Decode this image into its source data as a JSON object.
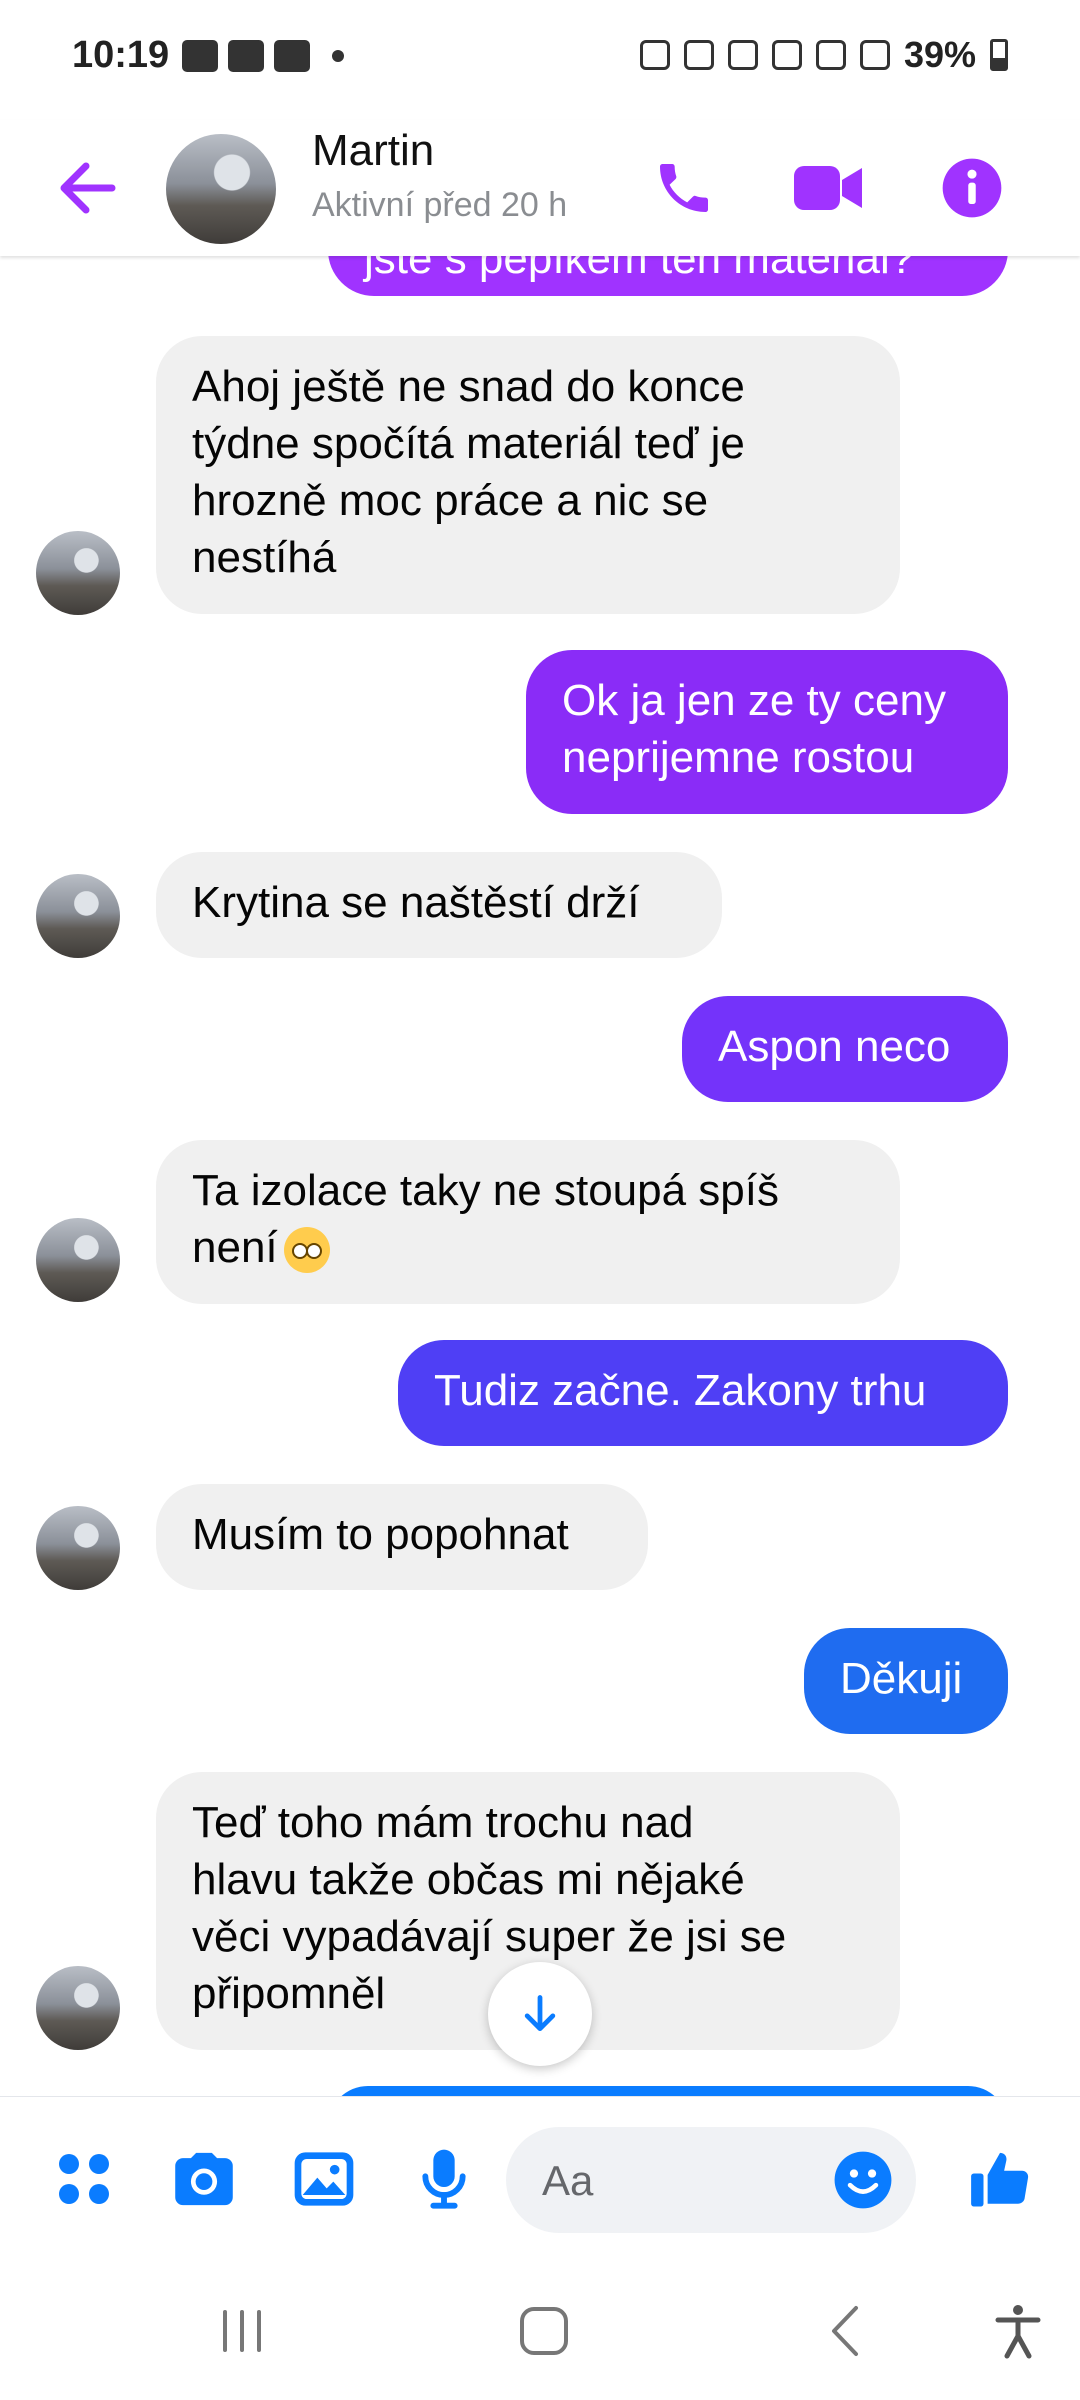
{
  "status_bar": {
    "time": "10:19",
    "battery": "39%"
  },
  "header": {
    "name": "Martin",
    "status": "Aktivní před 20 h"
  },
  "messages": [
    {
      "dir": "out",
      "text": "jste s pepíkem ten materiál?",
      "color": "#a033ff"
    },
    {
      "dir": "in",
      "text": "Ahoj ještě ne snad do konce\ntýdne spočítá materiál teď je\nhrozně moc práce a nic se\nnestíhá"
    },
    {
      "dir": "out",
      "text": "Ok ja jen ze ty ceny\nneprijemne rostou",
      "color": "#8a2cf7"
    },
    {
      "dir": "in",
      "text": "Krytina se naštěstí drží"
    },
    {
      "dir": "out",
      "text": "Aspon neco",
      "color": "#7433fa"
    },
    {
      "dir": "in",
      "text": "Ta izolace taky ne stoupá spíš\nnení",
      "emoji": "face-with-rolling-eyes"
    },
    {
      "dir": "out",
      "text": "Tudiz začne. Zakony trhu",
      "color": "#4f3ff5"
    },
    {
      "dir": "in",
      "text": "Musím to popohnat"
    },
    {
      "dir": "out",
      "text": "Děkuji",
      "color": "#1f6cf0"
    },
    {
      "dir": "in",
      "text": "Teď toho mám trochu nad\nhlavu takže občas mi nějaké\nvěci vypadávají super že jsi se\npřipomněl"
    }
  ],
  "composer": {
    "placeholder": "Aa"
  },
  "colors": {
    "accent": "#a033ff",
    "composer_blue": "#0a7cff"
  },
  "icons": [
    "back-arrow-icon",
    "phone-icon",
    "video-camera-icon",
    "info-icon",
    "apps-icon",
    "camera-icon",
    "image-icon",
    "microphone-icon",
    "emoji-icon",
    "thumbs-up-icon",
    "arrow-down-icon",
    "recent-apps-icon",
    "home-icon",
    "back-icon",
    "accessibility-icon"
  ]
}
